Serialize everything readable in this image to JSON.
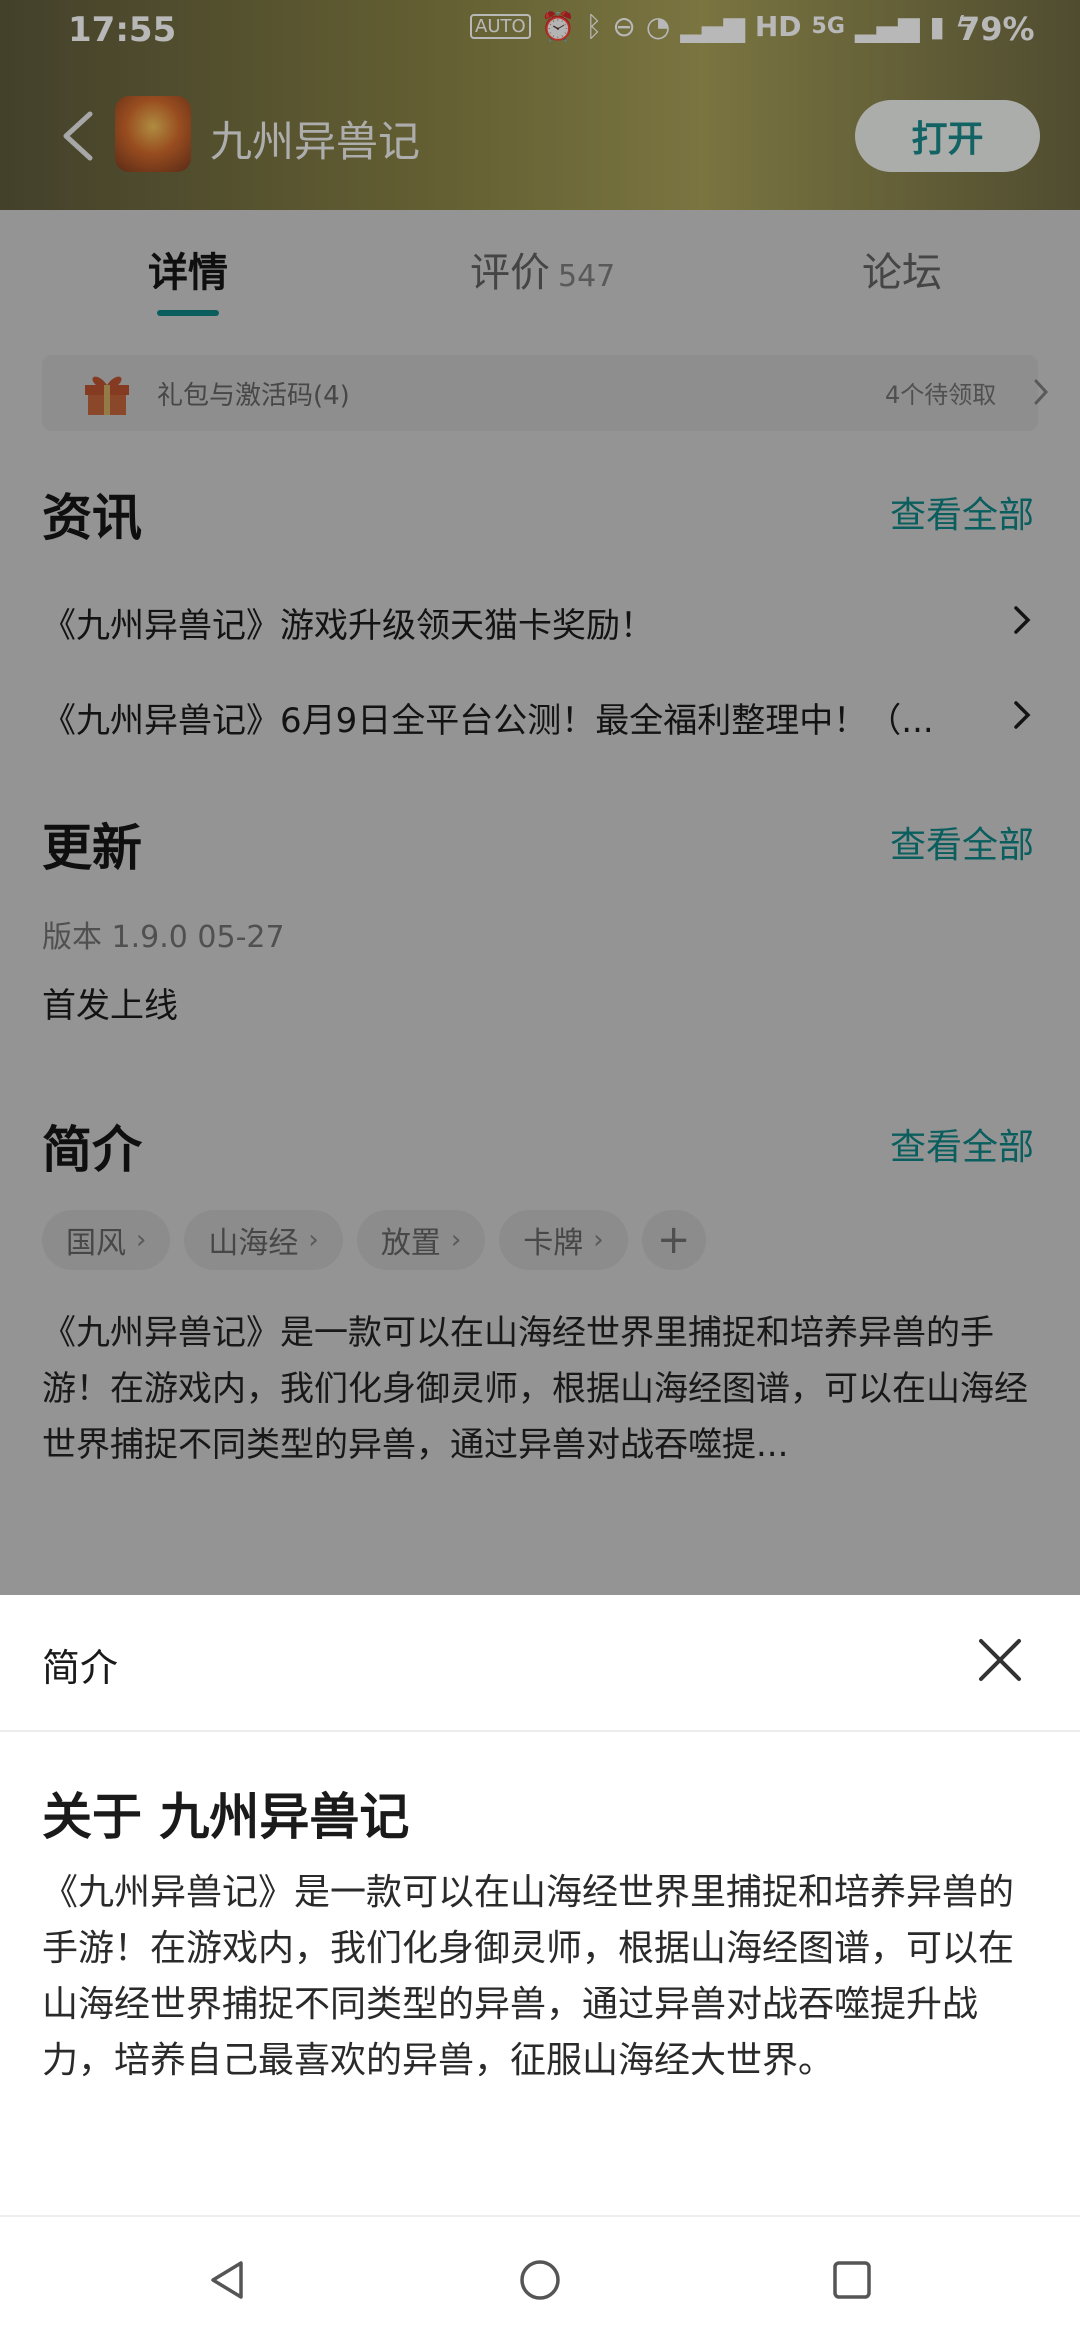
{
  "status_bar": {
    "time": "17:55",
    "auto_badge": "AUTO",
    "hd": "HD",
    "network": "5G",
    "battery": "79%"
  },
  "header": {
    "app_name": "九州异兽记",
    "open_button": "打开"
  },
  "tabs": [
    {
      "label": "详情"
    },
    {
      "label": "评价",
      "count": "547"
    },
    {
      "label": "论坛"
    }
  ],
  "gift_bar": {
    "label": "礼包与激活码(4)",
    "pending": "4个待领取"
  },
  "news": {
    "title": "资讯",
    "view_all": "查看全部",
    "items": [
      "《九州异兽记》游戏升级领天猫卡奖励！",
      "《九州异兽记》6月9日全平台公测！最全福利整理中！（..."
    ]
  },
  "update": {
    "title": "更新",
    "view_all": "查看全部",
    "version": "版本 1.9.0    05-27",
    "notes": "首发上线"
  },
  "intro": {
    "title": "简介",
    "view_all": "查看全部",
    "tags": [
      "国风",
      "山海经",
      "放置",
      "卡牌"
    ],
    "add_tag": "+",
    "text": "《九州异兽记》是一款可以在山海经世界里捕捉和培养异兽的手游！在游戏内，我们化身御灵师，根据山海经图谱，可以在山海经世界捕捉不同类型的异兽，通过异兽对战吞噬提..."
  },
  "sheet": {
    "title": "简介",
    "heading": "关于 九州异兽记",
    "description": "《九州异兽记》是一款可以在山海经世界里捕捉和培养异兽的手游！在游戏内，我们化身御灵师，根据山海经图谱，可以在山海经世界捕捉不同类型的异兽，通过异兽对战吞噬提升战力，培养自己最喜欢的异兽，征服山海经大世界。"
  },
  "colors": {
    "accent": "#14a3a3",
    "open_button_text": "#1b8a8c"
  }
}
